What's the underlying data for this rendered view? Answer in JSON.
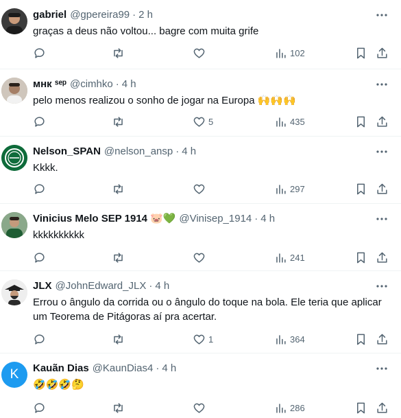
{
  "tweets": [
    {
      "name": "gabriel",
      "handle": "@gpereira99",
      "sep": "·",
      "time": "2 h",
      "text": "graças a deus não voltou... bagre com muita grife",
      "likes": "",
      "views": "102",
      "avatar_color": "#3b3b3b"
    },
    {
      "name": "мнк ˢᵉᵖ",
      "handle": "@cimhko",
      "sep": "·",
      "time": "4 h",
      "text": "pelo menos realizou o sonho de jogar na Europa 🙌🙌🙌",
      "likes": "5",
      "views": "435",
      "avatar_color": "#7a6a5c"
    },
    {
      "name": "Nelson_SPAN",
      "handle": "@nelson_ansp",
      "sep": "·",
      "time": "4 h",
      "text": "Kkkk.",
      "likes": "",
      "views": "297",
      "avatar_color": "#0e6b3a"
    },
    {
      "name": "Vinicius Melo SEP 1914",
      "name_emojis": "🐷💚",
      "handle": "@Vinisep_1914",
      "sep": "·",
      "time": "4 h",
      "text": "kkkkkkkkkk",
      "likes": "",
      "views": "241",
      "avatar_color": "#2f4a2f"
    },
    {
      "name": "JLX",
      "handle": "@JohnEdward_JLX",
      "sep": "·",
      "time": "4 h",
      "text_line1": "Errou o ângulo da corrida ou o ângulo do toque na bola. Ele teria que aplicar",
      "text_line2": "um Teorema de Pitágoras aí pra acertar.",
      "likes": "1",
      "views": "364",
      "avatar_color": "#2b2b2b"
    },
    {
      "name": "Kauãn Dias",
      "handle": "@KaunDias4",
      "sep": "·",
      "time": "4 h",
      "text": "🤣🤣🤣🤔",
      "likes": "",
      "views": "286",
      "avatar_letter": "K",
      "avatar_color": "#1d9bf0"
    }
  ],
  "icons": {
    "reply": "reply-icon",
    "retweet": "retweet-icon",
    "like": "heart-icon",
    "views": "views-icon",
    "bookmark": "bookmark-icon",
    "share": "share-icon",
    "more": "more-icon"
  },
  "colors": {
    "text": "#0f1419",
    "muted": "#536471",
    "divider": "#eff3f4",
    "accent": "#1d9bf0"
  }
}
